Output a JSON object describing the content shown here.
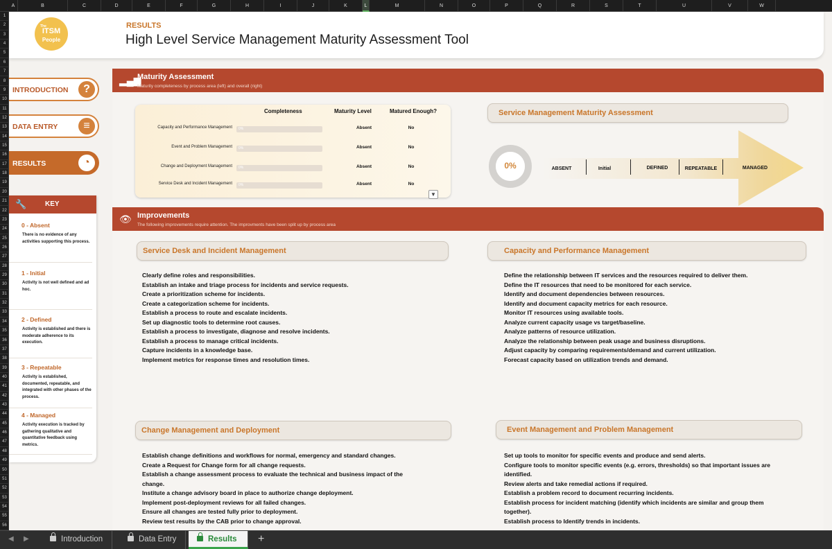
{
  "columns": [
    "A",
    "B",
    "C",
    "D",
    "E",
    "F",
    "G",
    "H",
    "I",
    "J",
    "K",
    "L",
    "M",
    "N",
    "O",
    "P",
    "Q",
    "R",
    "S",
    "T",
    "U",
    "V",
    "W"
  ],
  "rows": [
    "1",
    "2",
    "3",
    "4",
    "5",
    "6",
    "7",
    "8",
    "9",
    "10",
    "11",
    "12",
    "13",
    "14",
    "15",
    "16",
    "17",
    "18",
    "19",
    "20",
    "21",
    "22",
    "23",
    "24",
    "25",
    "26",
    "27",
    "28",
    "29",
    "30",
    "31",
    "32",
    "33",
    "34",
    "35",
    "36",
    "37",
    "38",
    "39",
    "40",
    "41",
    "42",
    "43",
    "44",
    "45",
    "46",
    "47",
    "48",
    "49",
    "50",
    "51",
    "52",
    "53",
    "54",
    "55",
    "56"
  ],
  "header": {
    "logo_small": "The",
    "logo_main": "ITSM",
    "logo_sub": "People",
    "breadcrumb": "RESULTS",
    "title": "High Level Service Management Maturity Assessment Tool"
  },
  "sidebar": {
    "nav": [
      {
        "label": "INTRODUCTION",
        "icon": "?"
      },
      {
        "label": "DATA ENTRY",
        "icon": "≡"
      },
      {
        "label": "RESULTS",
        "icon": "◔"
      }
    ],
    "key": {
      "title": "KEY",
      "items": [
        {
          "title": "0 - Absent",
          "desc": "There is no evidence of any activities supporting this process."
        },
        {
          "title": "1 - Initial",
          "desc": "Activity is not well defined and ad hoc."
        },
        {
          "title": "2 - Defined",
          "desc": "Activity is established and there is moderate adherence to its execution."
        },
        {
          "title": "3 - Repeatable",
          "desc": "Activity is established, documented, repeatable, and integrated with other phases of the process."
        },
        {
          "title": "4 - Managed",
          "desc": "Activity execution is tracked by gathering qualitative and quantitative feedback using metrics."
        }
      ]
    }
  },
  "maturity": {
    "title": "Maturity Assessment",
    "subtitle": "Maturity completeness by process area (left) and overall (right)",
    "columns": {
      "completeness": "Completeness",
      "level": "Maturity Level",
      "enough": "Matured Enough?"
    },
    "rows": [
      {
        "process": "Capacity and Performance Management",
        "completeness": "0%",
        "completeness_value": 0,
        "level": "Absent",
        "enough": "No"
      },
      {
        "process": "Event and Problem Management",
        "completeness": "0%",
        "completeness_value": 0,
        "level": "Absent",
        "enough": "No"
      },
      {
        "process": "Change and Deployment Management",
        "completeness": "0%",
        "completeness_value": 0,
        "level": "Absent",
        "enough": "No"
      },
      {
        "process": "Service Desk and Incident Management",
        "completeness": "0%",
        "completeness_value": 0,
        "level": "Absent",
        "enough": "No"
      }
    ],
    "overall_title": "Service Management Maturity Assessment",
    "overall_value": "0%",
    "stages": [
      "ABSENT",
      "Initial",
      "DEFINED",
      "REPEATABLE",
      "MANAGED"
    ],
    "colors": {
      "accent": "#c9762a",
      "header_bg": "#b5482e"
    }
  },
  "improvements": {
    "title": "Improvements",
    "subtitle": "The following improvements require attention. The improvments have been split up by process area",
    "sections": [
      {
        "title": "Service Desk and Incident Management",
        "items": [
          "Clearly define roles and responsibilities.",
          "Establish an intake and triage process for incidents and service requests.",
          "Create a prioritization scheme for incidents.",
          "Create a categorization scheme for incidents.",
          "Establish a process to route and escalate incidents.",
          "Set up diagnostic tools to determine root causes.",
          "Establish a process to investigate, diagnose and resolve incidents.",
          "Establish a process to manage critical incidents.",
          "Capture incidents in a knowledge base.",
          "Implement metrics for response times and resolution times."
        ]
      },
      {
        "title": "Capacity and Performance Management",
        "items": [
          "Define the relationship between IT services and the resources required to deliver them.",
          "Define the IT resources that need to be monitored for each service.",
          "Identify and document dependencies between resources.",
          "Identify and document capacity metrics for each resource.",
          "Monitor IT resources using available tools.",
          "Analyze current capacity usage vs target/baseline.",
          "Analyze patterns of resource utilization.",
          "Analyze the relationship between peak usage and business disruptions.",
          "Adjust capacity by comparing requirements/demand and current utilization.",
          "Forecast capacity based on utilization trends and demand."
        ]
      },
      {
        "title": "Change Management and Deployment",
        "items": [
          "Establish change definitions and workflows for normal, emergency and standard changes.",
          "Create a Request for Change form for all change requests.",
          "Establish a change assessment process to evaluate the technical and business impact of the change.",
          "Institute a change advisory board in place to authorize change deployment.",
          "Implement post-deployment reviews for all failed changes.",
          "Ensure all changes are tested fully prior to deployment.",
          "Review test results by the CAB prior to change approval."
        ]
      },
      {
        "title": "Event Management and Problem Management",
        "items": [
          "Set up tools to monitor for specific events and produce and send alerts.",
          "Configure tools to monitor specific events (e.g. errors, thresholds) so that important issues are identified.",
          "Review alerts and take remedial actions if required.",
          "Establish a problem record to document recurring incidents.",
          "Establish process for incident matching (identify which incidents are similar and group them together).",
          "Establish process to Identify trends in incidents."
        ]
      }
    ]
  },
  "tabs": [
    {
      "label": "Introduction",
      "active": false
    },
    {
      "label": "Data Entry",
      "active": false
    },
    {
      "label": "Results",
      "active": true
    }
  ],
  "add_tab": "+"
}
